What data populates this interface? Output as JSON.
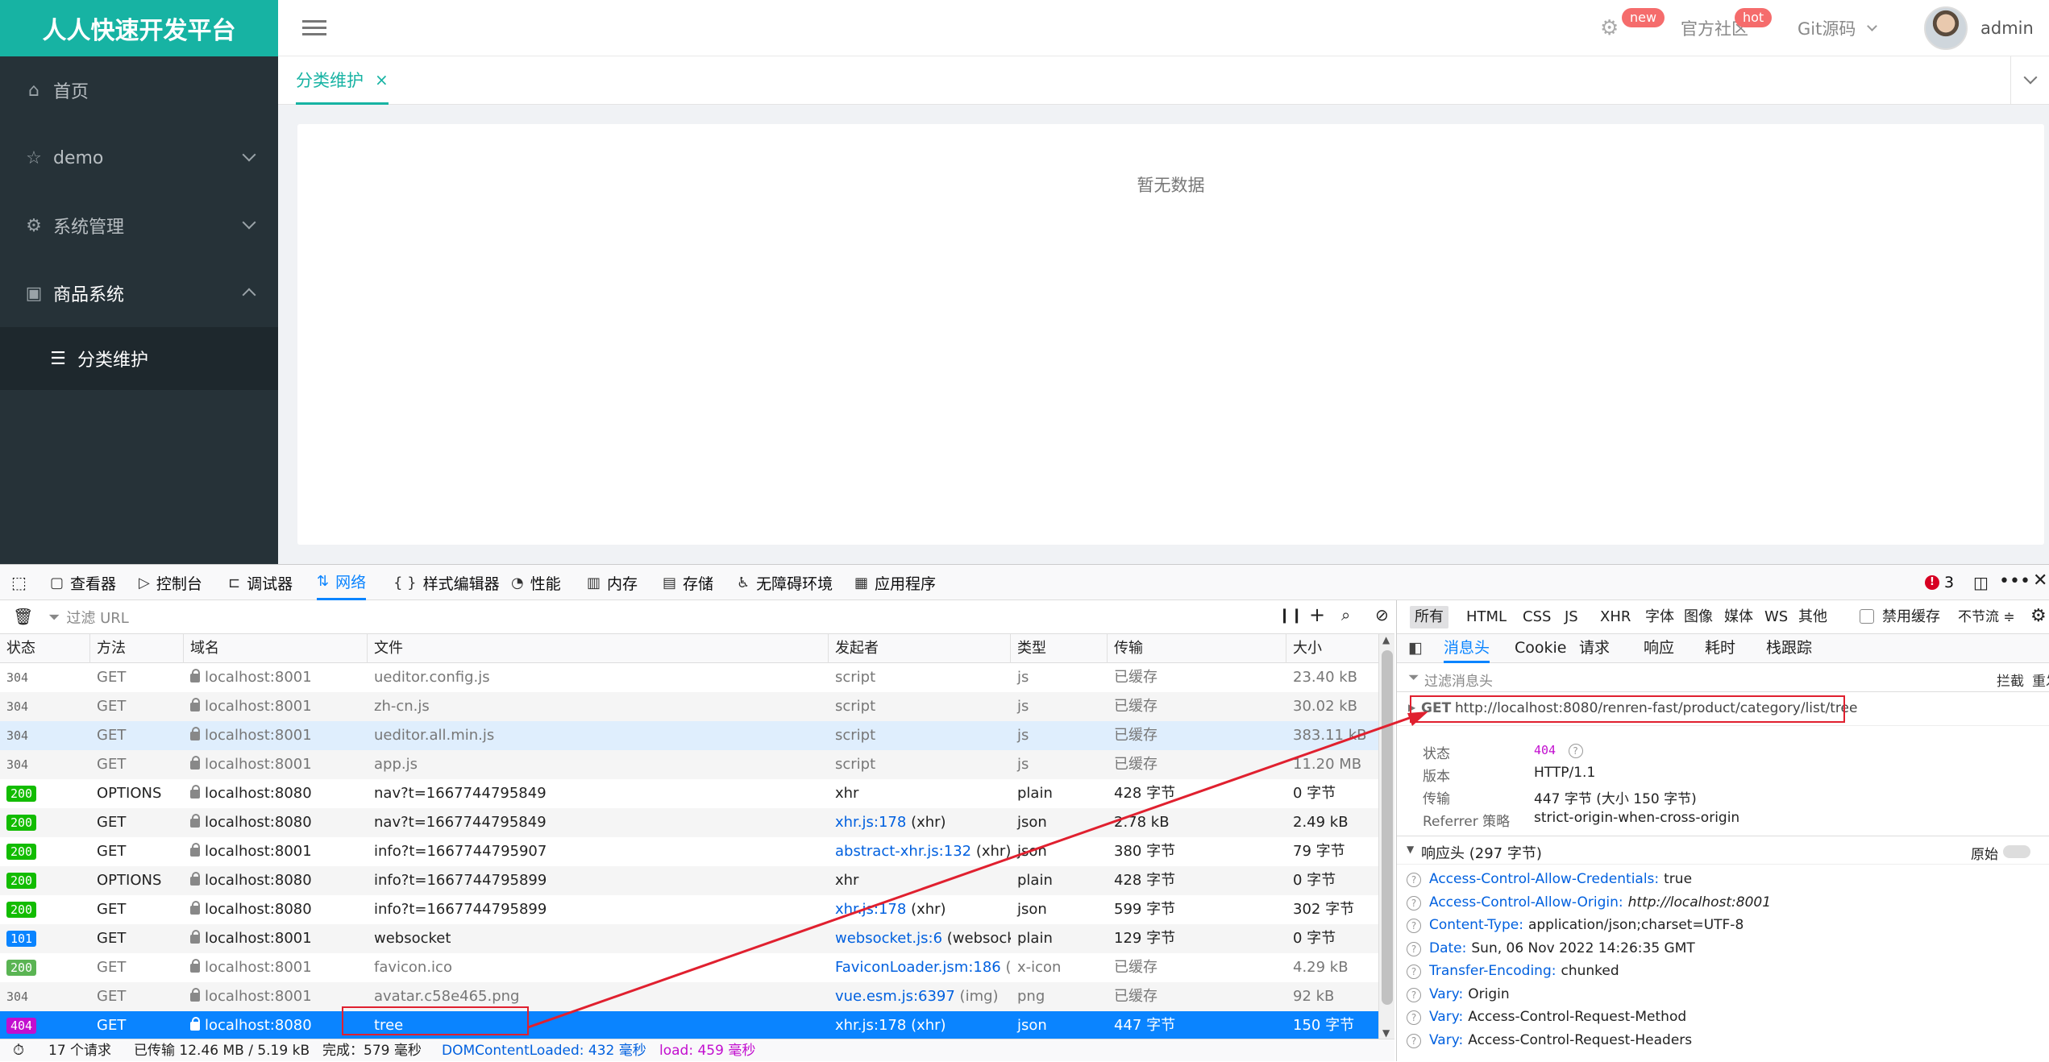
{
  "app": {
    "brand": "人人快速开发平台",
    "top": {
      "new_badge": "new",
      "community": "官方社区",
      "hot_badge": "hot",
      "git": "Git源码",
      "user": "admin"
    },
    "sidebar": [
      {
        "label": "首页"
      },
      {
        "label": "demo"
      },
      {
        "label": "系统管理"
      },
      {
        "label": "商品系统"
      }
    ],
    "submenu": {
      "label": "分类维护"
    },
    "tab": {
      "label": "分类维护",
      "close": "×"
    },
    "empty": "暂无数据"
  },
  "devtools": {
    "tabs": [
      "查看器",
      "控制台",
      "调试器",
      "网络",
      "样式编辑器",
      "性能",
      "内存",
      "存储",
      "无障碍环境",
      "应用程序"
    ],
    "error_count": "3",
    "filter_placeholder": "过滤 URL",
    "columns": [
      "状态",
      "方法",
      "域名",
      "文件",
      "发起者",
      "类型",
      "传输",
      "大小"
    ],
    "rows": [
      {
        "status": "304",
        "method": "GET",
        "domain": "localhost:8001",
        "file": "ueditor.config.js",
        "initiator": "script",
        "type": "js",
        "transfer": "已缓存",
        "size": "23.40 kB",
        "color": ""
      },
      {
        "status": "304",
        "method": "GET",
        "domain": "localhost:8001",
        "file": "zh-cn.js",
        "initiator": "script",
        "type": "js",
        "transfer": "已缓存",
        "size": "30.02 kB",
        "color": ""
      },
      {
        "status": "304",
        "method": "GET",
        "domain": "localhost:8001",
        "file": "ueditor.all.min.js",
        "initiator": "script",
        "type": "js",
        "transfer": "已缓存",
        "size": "383.11 kB",
        "color": ""
      },
      {
        "status": "304",
        "method": "GET",
        "domain": "localhost:8001",
        "file": "app.js",
        "initiator": "script",
        "type": "js",
        "transfer": "已缓存",
        "size": "11.20 MB",
        "color": ""
      },
      {
        "status": "200",
        "method": "OPTIONS",
        "domain": "localhost:8080",
        "file": "nav?t=1667744795849",
        "initiator": "xhr",
        "type": "plain",
        "transfer": "428 字节",
        "size": "0 字节",
        "color": "#12bc00"
      },
      {
        "status": "200",
        "method": "GET",
        "domain": "localhost:8080",
        "file": "nav?t=1667744795849",
        "initiator": "xhr.js:178",
        "initiator_extra": " (xhr)",
        "type": "json",
        "transfer": "2.78 kB",
        "size": "2.49 kB",
        "color": "#12bc00"
      },
      {
        "status": "200",
        "method": "GET",
        "domain": "localhost:8001",
        "file": "info?t=1667744795907",
        "initiator": "abstract-xhr.js:132",
        "initiator_extra": " (xhr)",
        "type": "json",
        "transfer": "380 字节",
        "size": "79 字节",
        "color": "#12bc00"
      },
      {
        "status": "200",
        "method": "OPTIONS",
        "domain": "localhost:8080",
        "file": "info?t=1667744795899",
        "initiator": "xhr",
        "type": "plain",
        "transfer": "428 字节",
        "size": "0 字节",
        "color": "#12bc00"
      },
      {
        "status": "200",
        "method": "GET",
        "domain": "localhost:8080",
        "file": "info?t=1667744795899",
        "initiator": "xhr.js:178",
        "initiator_extra": " (xhr)",
        "type": "json",
        "transfer": "599 字节",
        "size": "302 字节",
        "color": "#12bc00"
      },
      {
        "status": "101",
        "method": "GET",
        "domain": "localhost:8001",
        "file": "websocket",
        "initiator": "websocket.js:6",
        "initiator_extra": " (websocket)",
        "type": "plain",
        "transfer": "129 字节",
        "size": "0 字节",
        "color": "#0a84ff"
      },
      {
        "status": "200",
        "method": "GET",
        "domain": "localhost:8001",
        "file": "favicon.ico",
        "initiator": "FaviconLoader.jsm:186",
        "initiator_extra": " (i...",
        "type": "x-icon",
        "transfer": "已缓存",
        "size": "4.29 kB",
        "color": "#5ab453"
      },
      {
        "status": "304",
        "method": "GET",
        "domain": "localhost:8001",
        "file": "avatar.c58e465.png",
        "initiator": "vue.esm.js:6397",
        "initiator_extra": " (img)",
        "type": "png",
        "transfer": "已缓存",
        "size": "92 kB",
        "color": ""
      },
      {
        "status": "404",
        "method": "GET",
        "domain": "localhost:8080",
        "file": "tree",
        "initiator": "xhr.js:178",
        "initiator_extra": " (xhr)",
        "type": "json",
        "transfer": "447 字节",
        "size": "150 字节",
        "color": "#c20ecf"
      }
    ],
    "statusbar": {
      "requests": "17 个请求",
      "transferred": "已传输 12.46 MB / 5.19 kB",
      "finish": "完成：579 毫秒",
      "dcl": "DOMContentLoaded: 432 毫秒",
      "load": "load: 459 毫秒"
    },
    "type_filters": [
      "所有",
      "HTML",
      "CSS",
      "JS",
      "XHR",
      "字体",
      "图像",
      "媒体",
      "WS",
      "其他"
    ],
    "disable_cache": "禁用缓存",
    "throttle": "不节流 ≑",
    "detail_tabs": [
      "消息头",
      "Cookie",
      "请求",
      "响应",
      "耗时",
      "栈跟踪"
    ],
    "header_filter": "过滤消息头",
    "block": "拦截",
    "resend": "重发",
    "request_method": "GET",
    "request_url": "http://localhost:8080/renren-fast/product/category/list/tree",
    "summary": {
      "status_label": "状态",
      "status_value": "404",
      "version_label": "版本",
      "version_value": "HTTP/1.1",
      "transfer_label": "传输",
      "transfer_value": "447 字节 (大小 150 字节)",
      "referrer_label": "Referrer 策略",
      "referrer_value": "strict-origin-when-cross-origin"
    },
    "response_headers_title": "响应头 (297 字节)",
    "raw": "原始",
    "headers": [
      {
        "name": "Access-Control-Allow-Credentials:",
        "value": "true",
        "italic": false
      },
      {
        "name": "Access-Control-Allow-Origin:",
        "value": "http://localhost:8001",
        "italic": true
      },
      {
        "name": "Content-Type:",
        "value": "application/json;charset=UTF-8",
        "italic": false
      },
      {
        "name": "Date:",
        "value": "Sun, 06 Nov 2022 14:26:35 GMT",
        "italic": false
      },
      {
        "name": "Transfer-Encoding:",
        "value": "chunked",
        "italic": false
      },
      {
        "name": "Vary:",
        "value": "Origin",
        "italic": false
      },
      {
        "name": "Vary:",
        "value": "Access-Control-Request-Method",
        "italic": false
      },
      {
        "name": "Vary:",
        "value": "Access-Control-Request-Headers",
        "italic": false
      }
    ]
  }
}
